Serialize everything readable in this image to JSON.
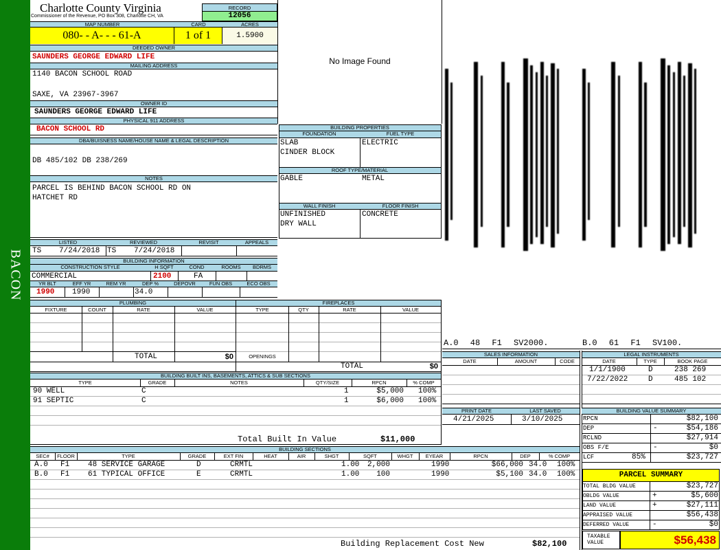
{
  "sidebar": {
    "label": "BACON"
  },
  "header": {
    "county": "Charlotte County Virginia",
    "commissioner": "Commissioner of the Revenue, PO Box 308, Charlotte CH, VA"
  },
  "record": {
    "label": "RECORD",
    "value": "12056"
  },
  "map": {
    "label": "MAP NUMBER",
    "value": "080- - A- - - 61-A"
  },
  "card": {
    "label": "CARD",
    "value": "1 of 1"
  },
  "acres": {
    "label": "ACRES",
    "value": "1.5900"
  },
  "deeded_owner": {
    "label": "DEEDED OWNER",
    "value": "SAUNDERS GEORGE EDWARD LIFE"
  },
  "mailing": {
    "label": "MAILING ADDRESS",
    "line1": "1140 BACON SCHOOL ROAD",
    "line2": "SAXE, VA 23967-3967"
  },
  "owner_id": {
    "label": "OWNER ID",
    "value": "SAUNDERS GEORGE EDWARD LIFE"
  },
  "physical": {
    "label": "PHYSICAL 911 ADDRESS",
    "value": "BACON SCHOOL RD"
  },
  "dba": {
    "label": "DBA/BUISNESS NAME/HOUSE NAME & LEGAL DESCRIPTION",
    "value": "DB 485/102 DB 238/269"
  },
  "notes": {
    "label": "NOTES",
    "line1": "PARCEL IS BEHIND BACON SCHOOL RD ON",
    "line2": "HATCHET RD"
  },
  "image": {
    "text": "No Image Found"
  },
  "sketch": {
    "caption_a": "A.0 48 F1 SV2000.",
    "caption_b": "B.0 61 F1 SV100."
  },
  "building_properties": {
    "label": "BUILDING PROPERTIES",
    "foundation_label": "FOUNDATION",
    "fuel_label": "FUEL TYPE",
    "foundation1": "SLAB",
    "foundation2": "CINDER BLOCK",
    "fuel": "ELECTRIC",
    "roof_label": "ROOF TYPE/MATERIAL",
    "roof_type": "GABLE",
    "roof_material": "METAL",
    "wall_label": "WALL FINISH",
    "floor_label": "FLOOR FINISH",
    "wall1": "UNFINISHED",
    "wall2": "DRY WALL",
    "floor": "CONCRETE"
  },
  "listing": {
    "listed_label": "LISTED",
    "reviewed_label": "REVIEWED",
    "revisit_label": "REVISIT",
    "appeals_label": "APPEALS",
    "listed_by": "TS",
    "listed_date": "7/24/2018",
    "reviewed_by": "TS",
    "reviewed_date": "7/24/2018"
  },
  "building_info": {
    "label": "BUILDING INFORMATION",
    "style_label": "CONSTRUCTION STYLE",
    "hsqft_label": "H SQFT",
    "cond_label": "COND",
    "rooms_label": "ROOMS",
    "bdrms_label": "BDRMS",
    "style": "COMMERCIAL",
    "hsqft": "2100",
    "cond": "FA",
    "yrblt_label": "YR BLT",
    "effyr_label": "EFF YR",
    "remyr_label": "REM YR",
    "dep_label": "DEP %",
    "depovr_label": "DEPOVR",
    "funobs_label": "FUN OBS",
    "ecoobs_label": "ECO OBS",
    "yrblt": "1990",
    "effyr": "1990",
    "dep": "34.0"
  },
  "plumbing": {
    "label": "PLUMBING",
    "cols": [
      "FIXTURE",
      "COUNT",
      "RATE",
      "VALUE"
    ],
    "total_label": "TOTAL",
    "total": "$0"
  },
  "fireplaces": {
    "label": "FIREPLACES",
    "cols": [
      "TYPE",
      "QTY",
      "RATE",
      "VALUE"
    ],
    "openings_label": "OPENINGS",
    "total_label": "TOTAL",
    "total": "$0"
  },
  "builtins": {
    "label": "BUILDING BUILT INS, BASEMENTS, ATTICS & SUB SECTIONS",
    "cols": [
      "TYPE",
      "GRADE",
      "NOTES",
      "QTY/SIZE",
      "RPCN",
      "% COMP"
    ],
    "rows": [
      {
        "type": "90 WELL",
        "grade": "C",
        "qty": "1",
        "rpcn": "$5,000",
        "comp": "100%"
      },
      {
        "type": "91 SEPTIC",
        "grade": "C",
        "qty": "1",
        "rpcn": "$6,000",
        "comp": "100%"
      }
    ],
    "total_label": "Total Built In Value",
    "total": "$11,000"
  },
  "sections": {
    "label": "BUILDING SECTIONS",
    "cols": [
      "SEC#",
      "FLOOR",
      "TYPE",
      "GRADE",
      "EXT FIN",
      "HEAT",
      "AIR",
      "SHGT",
      "SQFT",
      "WHGT",
      "EYEAR",
      "RPCN",
      "DEP",
      "% COMP"
    ],
    "rows": [
      {
        "sec": "A.0",
        "floor": "F1",
        "type": "48 SERVICE GARAGE",
        "grade": "D",
        "ext": "CRMTL",
        "shgt": "1.00",
        "sqft": "2,000",
        "eyear": "1990",
        "rpcn": "$66,000",
        "dep": "34.0",
        "comp": "100%"
      },
      {
        "sec": "B.0",
        "floor": "F1",
        "type": "61 TYPICAL OFFICE",
        "grade": "E",
        "ext": "CRMTL",
        "shgt": "1.00",
        "sqft": "100",
        "eyear": "1990",
        "rpcn": "$5,100",
        "dep": "34.0",
        "comp": "100%"
      }
    ],
    "rcn_label": "Building Replacement Cost New",
    "rcn": "$82,100"
  },
  "sales": {
    "label": "SALES INFORMATION",
    "cols": [
      "DATE",
      "AMOUNT",
      "CODE"
    ]
  },
  "legal": {
    "label": "LEGAL INSTRUMENTS",
    "cols": [
      "DATE",
      "TYPE",
      "BOOK PAGE"
    ],
    "rows": [
      {
        "date": "1/1/1900",
        "type": "D",
        "book": "238 269"
      },
      {
        "date": "7/22/2022",
        "type": "D",
        "book": "485 102"
      }
    ]
  },
  "print": {
    "print_label": "PRINT DATE",
    "saved_label": "LAST SAVED",
    "print_date": "4/21/2025",
    "saved_date": "3/10/2025"
  },
  "value_summary": {
    "label": "BUILDING VALUE SUMMARY",
    "rows": [
      {
        "k": "RPCN",
        "s": "",
        "v": "$82,100"
      },
      {
        "k": "DEP",
        "s": "-",
        "v": "$54,186"
      },
      {
        "k": "RCLND",
        "s": "",
        "v": "$27,914"
      },
      {
        "k": "OBS F/E",
        "s": "-",
        "v": "$0"
      },
      {
        "k": "LCF",
        "p": "85%",
        "s": "",
        "v": "$23,727"
      }
    ]
  },
  "parcel": {
    "label": "PARCEL SUMMARY",
    "rows": [
      {
        "k": "TOTAL BLDG VALUE",
        "s": "",
        "v": "$23,727"
      },
      {
        "k": "OBLDG VALUE",
        "s": "+",
        "v": "$5,600"
      },
      {
        "k": "LAND VALUE",
        "s": "+",
        "v": "$27,111"
      },
      {
        "k": "APPRAISED VALUE",
        "s": "",
        "v": "$56,438"
      },
      {
        "k": "DEFERRED VALUE",
        "s": "-",
        "v": "$0"
      }
    ],
    "taxable_label1": "TAXABLE",
    "taxable_label2": "VALUE",
    "taxable": "$56,438"
  },
  "colors": {
    "sidebar": "#0a7d0a",
    "header": "#add8e6",
    "highlight": "#ffff00",
    "record": "#90ee90",
    "red": "#d00000"
  }
}
